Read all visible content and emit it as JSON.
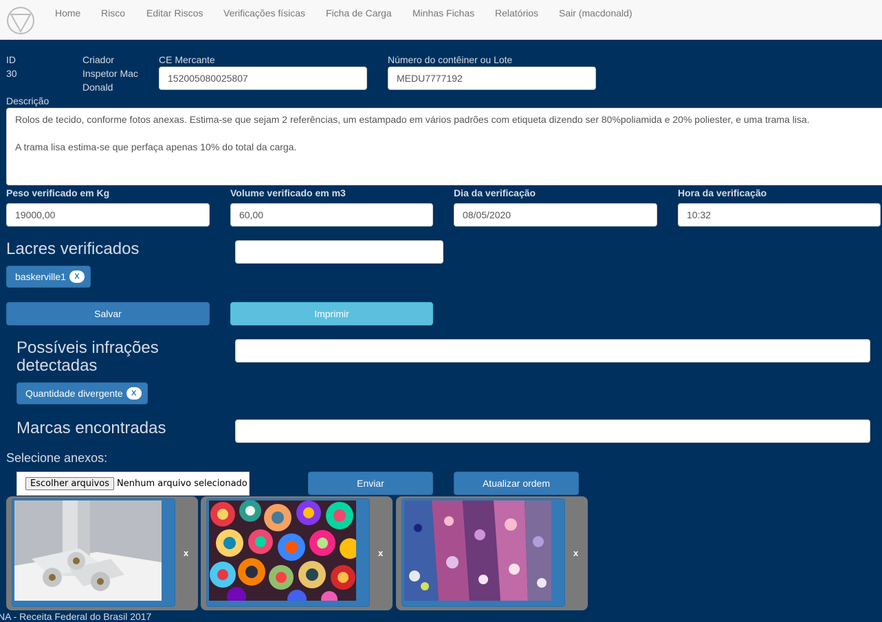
{
  "nav": {
    "logo": "triangle-in-circle logo",
    "items": [
      "Home",
      "Risco",
      "Editar Riscos",
      "Verificações físicas",
      "Ficha de Carga",
      "Minhas Fichas",
      "Relatórios",
      "Sair (macdonald)"
    ]
  },
  "record": {
    "id_label": "ID",
    "id_value": "30",
    "creator_label": "Criador",
    "creator_value_1": "Inspetor Mac",
    "creator_value_2": "Donald",
    "ce_label": "CE Mercante",
    "ce_value": "152005080025807",
    "container_label": "Número do contêiner ou Lote",
    "container_value": "MEDU7777192",
    "description_label": "Descrição",
    "description_value": "Rolos de tecido, conforme fotos anexas. Estima-se que sejam 2 referências, um estampado em vários padrões com etiqueta dizendo ser 80%poliamida e 20% poliester, e uma trama lisa.\n\nA trama lisa estima-se que perfaça apenas 10% do total da carga."
  },
  "verification": {
    "weight_label": "Peso verificado em Kg",
    "weight_value": "19000,00",
    "volume_label": "Volume verificado em m3",
    "volume_value": "60,00",
    "date_label": "Dia da verificação",
    "date_value": "08/05/2020",
    "time_label": "Hora da verificação",
    "time_value": "10:32"
  },
  "seals": {
    "title": "Lacres verificados",
    "input_value": "",
    "tags": [
      "baskerville1"
    ]
  },
  "tag_remove": "X",
  "actions": {
    "save": "Salvar",
    "print": "Imprimir"
  },
  "infractions": {
    "title_1": "Possíveis infrações",
    "title_2": "detectadas",
    "input_value": "",
    "tags": [
      "Quantidade divergente"
    ]
  },
  "marks": {
    "title": "Marcas encontradas",
    "input_value": ""
  },
  "attachments": {
    "title": "Selecione anexos:",
    "file_button": "Escolher arquivos",
    "file_status": "Nenhum arquivo selecionado",
    "send": "Enviar",
    "reorder": "Atualizar ordem",
    "remove": "x",
    "images": [
      "white fabric rolls photo",
      "colorful rolled fabric photo",
      "printed fabric rolls photo"
    ]
  },
  "footer": "NA - Receita Federal do Brasil 2017",
  "colors": {
    "page_bg": "#00305e",
    "primary": "#337ab7",
    "info": "#5bc0de",
    "navbar": "#f8f8f8"
  }
}
